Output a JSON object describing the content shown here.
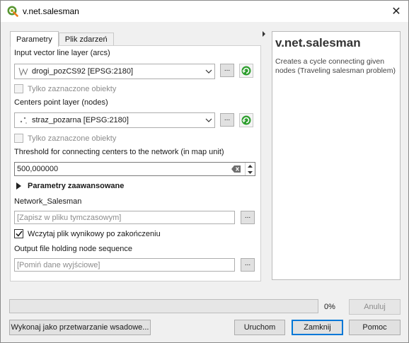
{
  "window": {
    "title": "v.net.salesman",
    "close_glyph": "✕",
    "app_icon": "qgis-logo-icon"
  },
  "tabs": [
    {
      "label": "Parametry",
      "active": true
    },
    {
      "label": "Plik zdarzeń",
      "active": false
    }
  ],
  "params": {
    "input_layer": {
      "label": "Input vector line layer (arcs)",
      "value": "drogi_pozCS92 [EPSG:2180]",
      "icon": "line-layer-icon",
      "selected_only": "Tylko zaznaczone obiekty",
      "selected_only_checked": false
    },
    "centers_layer": {
      "label": "Centers point layer (nodes)",
      "value": "straz_pozarna [EPSG:2180]",
      "icon": "point-layer-icon",
      "selected_only": "Tylko zaznaczone obiekty",
      "selected_only_checked": false
    },
    "threshold": {
      "label": "Threshold for connecting centers to the network (in map unit)",
      "value": "500,000000"
    },
    "advanced_label": "Parametry zaawansowane",
    "network_output": {
      "label": "Network_Salesman",
      "placeholder": "[Zapisz w pliku tymczasowym]"
    },
    "load_output": {
      "label": "Wczytaj plik wynikowy po zakończeniu",
      "checked": true
    },
    "sequence_output": {
      "label": "Output file holding node sequence",
      "placeholder": "[Pomiń dane wyjściowe]"
    },
    "dots_label": "..."
  },
  "help": {
    "title": "v.net.salesman",
    "description": "Creates a cycle connecting given nodes (Traveling salesman problem)"
  },
  "progress": {
    "value": 0,
    "label": "0%"
  },
  "buttons": {
    "cancel": "Anuluj",
    "batch": "Wykonaj jako przetwarzanie wsadowe...",
    "run": "Uruchom",
    "close": "Zamknij",
    "help": "Pomoc"
  },
  "colors": {
    "accent": "#0078d7",
    "iterate_green": "#2e9e2e"
  }
}
